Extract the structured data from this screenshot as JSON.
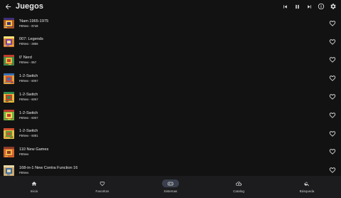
{
  "appbar": {
    "title": "Juegos",
    "back_icon": "arrow-left-icon",
    "actions": [
      "skip-previous-icon",
      "pause-icon",
      "skip-next-icon",
      "info-icon",
      "settings-icon"
    ]
  },
  "games": [
    {
      "name": "'Nam 1965-1975",
      "system": "FBNeo - 8748",
      "palette": [
        "#b85a1e",
        "#f2c14e",
        "#3b2f7a"
      ]
    },
    {
      "name": "007: Legends",
      "system": "FBNeo - 2886",
      "palette": [
        "#d9832c",
        "#7a3ea8",
        "#f3e27a"
      ]
    },
    {
      "name": "0' Nerd",
      "system": "FBNeo - 857",
      "palette": [
        "#3c8f4a",
        "#e7b93a",
        "#c23c2c"
      ]
    },
    {
      "name": "1-2-Switch",
      "system": "FBNeo - 6057",
      "palette": [
        "#e3a23a",
        "#d24a2a",
        "#3b6fb5"
      ]
    },
    {
      "name": "1-2-Switch",
      "system": "FBNeo - 6057",
      "palette": [
        "#f0b83a",
        "#c5402a",
        "#2e8a4e"
      ]
    },
    {
      "name": "1-2-Switch",
      "system": "FBNeo - 6057",
      "palette": [
        "#6fb33e",
        "#f2d45a",
        "#c0392b"
      ]
    },
    {
      "name": "1-2-Switch",
      "system": "FBNeo - 6081",
      "palette": [
        "#e9c04a",
        "#5a9e3a",
        "#d2502e"
      ]
    },
    {
      "name": "110 New Games",
      "system": "FBNeo",
      "palette": [
        "#d7652d",
        "#f1b544",
        "#8a3a2a"
      ]
    },
    {
      "name": "168-in-1 New Contra Function 16",
      "system": "FBNeo",
      "palette": [
        "#c9a46a",
        "#3e6c9c",
        "#e6d6a8"
      ]
    }
  ],
  "nav": [
    {
      "label": "Inicio",
      "icon": "home-icon",
      "active": false
    },
    {
      "label": "Favoritos",
      "icon": "heart-outline-icon",
      "active": false
    },
    {
      "label": "Sistemas",
      "icon": "gamepad-icon",
      "active": true
    },
    {
      "label": "Catalog",
      "icon": "cloud-download-icon",
      "active": false
    },
    {
      "label": "Búsqueda",
      "icon": "search-icon",
      "active": false
    }
  ],
  "colors": {
    "background": "#121212",
    "bottom_bar": "#1c1c1e",
    "active_pill": "#3a3f4d",
    "text": "#ededed",
    "subtext": "#a9a9a9"
  }
}
